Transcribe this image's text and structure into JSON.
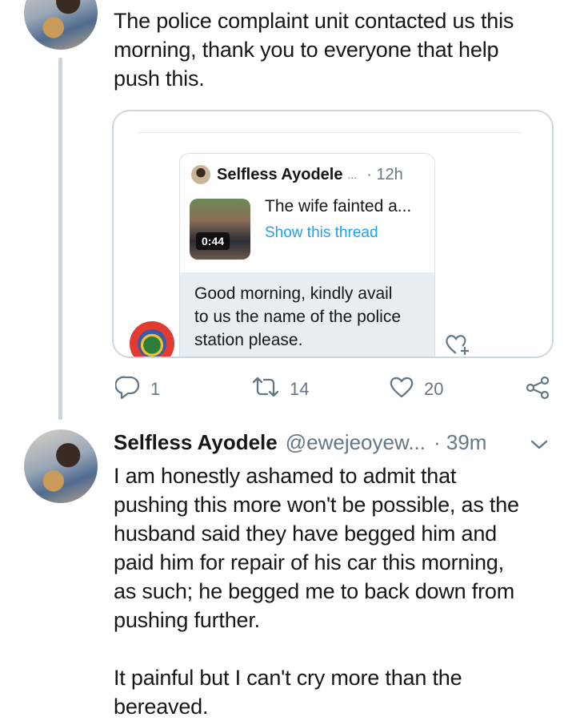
{
  "tweet1": {
    "text_lines": [
      "The police complaint unit contacted us this",
      "morning, thank you to everyone that help",
      "push this."
    ]
  },
  "quoted": {
    "inner_name": "Selfless Ayodele",
    "inner_ellipsis": "...",
    "inner_time": "· 12h",
    "inner_text": "The wife fainted a...",
    "show_thread": "Show this thread",
    "video_duration": "0:44",
    "reply_lines": [
      "Good morning, kindly avail",
      "to us the name of the police",
      "station please."
    ]
  },
  "actions": {
    "replies": "1",
    "retweets": "14",
    "likes": "20"
  },
  "tweet2": {
    "name": "Selfless Ayodele",
    "handle": "@ewejeoyew...",
    "time": "· 39m",
    "paragraph1_lines": [
      "I am honestly ashamed to admit that",
      "pushing this more won't be possible, as the",
      "husband said they have begged him and",
      "paid him for repair of his car this morning,",
      "as such; he begged me to back down from",
      "pushing further."
    ],
    "paragraph2_lines": [
      "It painful but I can't cry more than the",
      "bereaved."
    ]
  },
  "colors": {
    "accent": "#1da1f2",
    "muted": "#657786",
    "text": "#14171a",
    "border": "#ccd6dd"
  },
  "icons": [
    "reply-icon",
    "retweet-icon",
    "like-icon",
    "share-icon",
    "chevron-down-icon",
    "like-plus-icon"
  ]
}
